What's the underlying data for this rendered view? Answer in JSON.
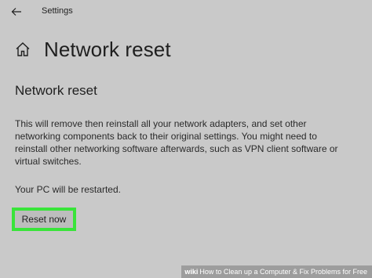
{
  "titlebar": {
    "back_icon": "back-arrow-icon",
    "label": "Settings"
  },
  "header": {
    "home_icon": "home-icon",
    "title": "Network reset"
  },
  "content": {
    "section_title": "Network reset",
    "description": "This will remove then reinstall all your network adapters, and set other networking components back to their original settings. You might need to reinstall other networking software afterwards, such as VPN client software or virtual switches.",
    "restart_note": "Your PC will be restarted.",
    "reset_button_label": "Reset now",
    "highlight_color": "#39e43a"
  },
  "watermark": {
    "brand": "wiki",
    "text": "How to Clean up a Computer & Fix Problems for Free"
  }
}
